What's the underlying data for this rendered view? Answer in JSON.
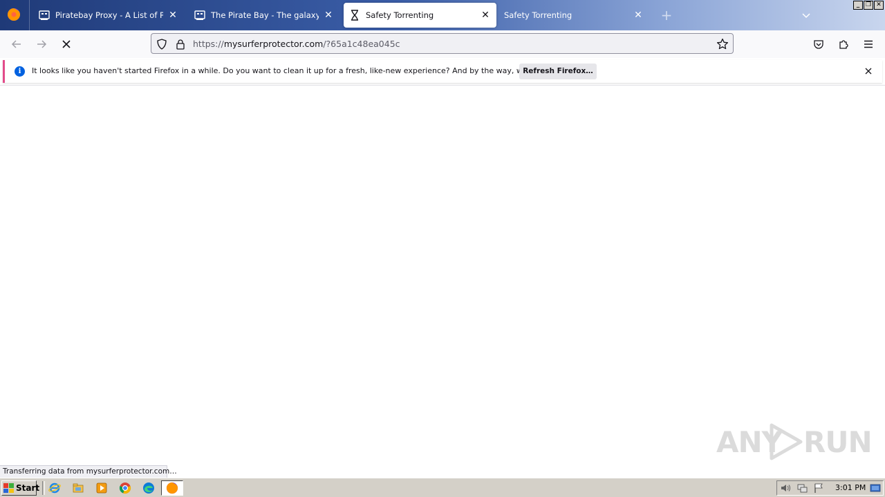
{
  "tabs": [
    {
      "title": "Piratebay Proxy - A List of Pirate B",
      "icon": "pirate-ship-icon",
      "active": false
    },
    {
      "title": "The Pirate Bay - The galaxy's most",
      "icon": "pirate-ship-icon",
      "active": false
    },
    {
      "title": "Safety Torrenting",
      "icon": "hourglass-loading-icon",
      "active": true
    },
    {
      "title": "Safety Torrenting",
      "icon": "",
      "active": false
    }
  ],
  "navbar": {
    "url_scheme": "https://",
    "url_host": "mysurferprotector.com",
    "url_path": "/?65a1c48ea045c"
  },
  "notification": {
    "message": "It looks like you haven't started Firefox in a while. Do you want to clean it up for a fresh, like-new experience? And by the way, welcome back!",
    "button_label": "Refresh Firefox…"
  },
  "status": {
    "text": "Transferring data from mysurferprotector.com…"
  },
  "watermark": {
    "left": "ANY",
    "right": "RUN"
  },
  "taskbar": {
    "start_label": "Start",
    "clock": "3:01 PM"
  },
  "colors": {
    "accent": "#0061e0",
    "notice_stripe": "#e24b8a",
    "tabstrip_dark": "#1f3a78",
    "taskbar": "#d4d0c8"
  }
}
